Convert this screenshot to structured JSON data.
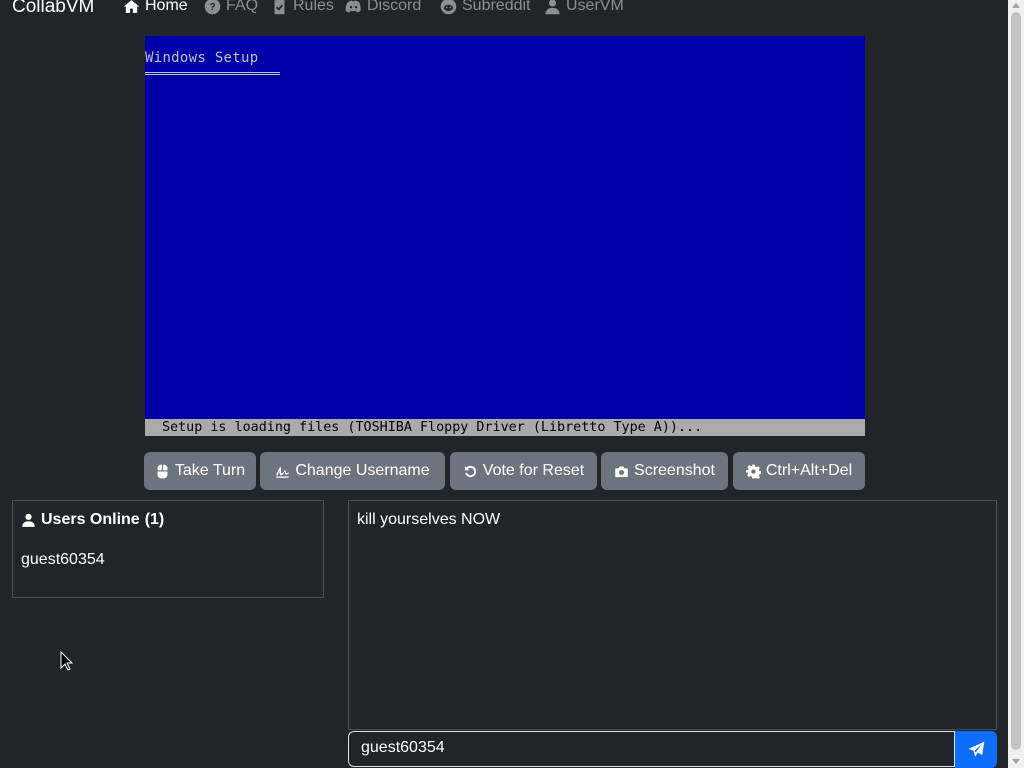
{
  "nav": {
    "brand": "CollabVM",
    "items": [
      {
        "label": "Home",
        "icon": "home-icon",
        "active": true
      },
      {
        "label": "FAQ",
        "icon": "question-circle-icon"
      },
      {
        "label": "Rules",
        "icon": "clipboard-check-icon"
      },
      {
        "label": "Discord",
        "icon": "discord-icon"
      },
      {
        "label": "Subreddit",
        "icon": "reddit-icon"
      },
      {
        "label": "UserVM",
        "icon": "user-icon"
      }
    ]
  },
  "vm": {
    "title": "Windows Setup",
    "status": "Setup is loading files (TOSHIBA Floppy Driver (Libretto Type A))...",
    "background_color": "#0000a8",
    "status_bar_color": "#aaaaaa"
  },
  "controls": [
    {
      "label": "Take Turn",
      "icon": "mouse-icon"
    },
    {
      "label": "Change Username",
      "icon": "signature-icon"
    },
    {
      "label": "Vote for Reset",
      "icon": "rotate-left-icon"
    },
    {
      "label": "Screenshot",
      "icon": "camera-icon"
    },
    {
      "label": "Ctrl+Alt+Del",
      "icon": "gear-icon"
    }
  ],
  "users": {
    "header": "Users Online",
    "count": "(1)",
    "list": [
      "guest60354"
    ]
  },
  "chat": {
    "messages": [
      {
        "text": "kill yourselves NOW"
      }
    ],
    "username": "guest60354",
    "input_value": "",
    "input_placeholder": ""
  },
  "colors": {
    "background": "#212529",
    "button": "#6c757d",
    "send_button": "#0d6efd"
  }
}
